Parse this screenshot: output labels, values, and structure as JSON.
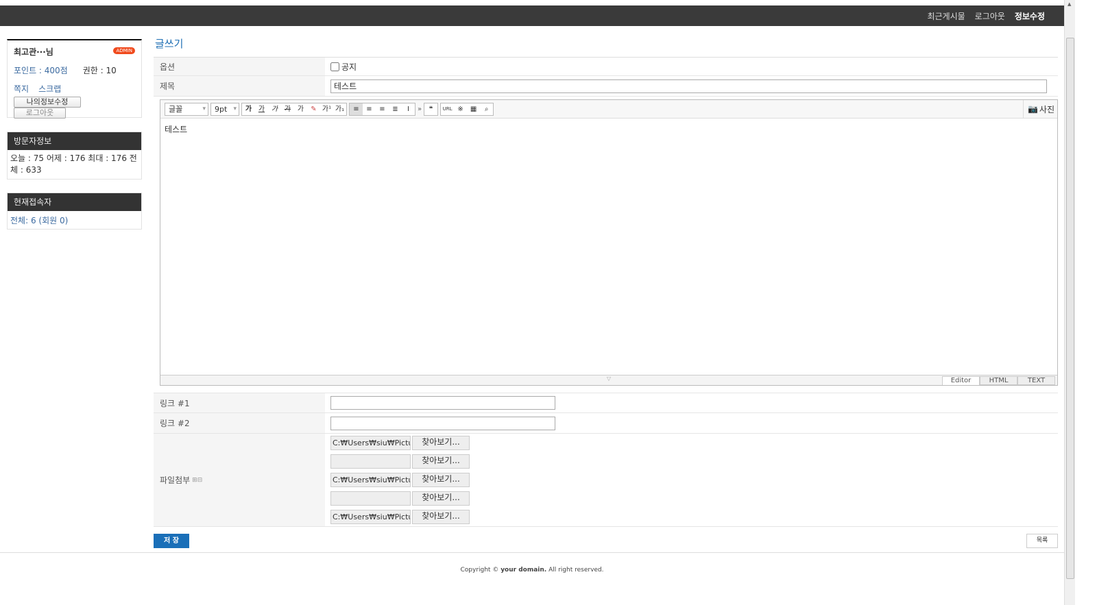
{
  "topnav": [
    "최근게시물",
    "로그아웃",
    "정보수정"
  ],
  "login": {
    "name": "최고관···님",
    "badge": "ADMIN",
    "points": "포인트 : 400점",
    "level": "권한 : 10",
    "memo": "쪽지",
    "scrap": "스크랩",
    "edit_btn": "나의정보수정",
    "logout_btn": "로그아웃"
  },
  "visitor": {
    "title": "방문자정보",
    "text": "오늘 : 75 어제 : 176 최대 : 176 전체 : 633"
  },
  "connect": {
    "title": "현재접속자",
    "text": "전체: 6 (회원 0)"
  },
  "page_title": "글쓰기",
  "form": {
    "option_label": "옵션",
    "notice_label": "공지",
    "subject_label": "제목",
    "subject_value": "테스트",
    "font_select": "글꼴",
    "size_select": "9pt",
    "photo_btn": "사진",
    "content": "테스트",
    "toolbar_icons": [
      "bold",
      "underline",
      "italic",
      "strike",
      "font-color",
      "bg-color",
      "superscript",
      "subscript",
      "align-left",
      "align-center",
      "align-right",
      "justify",
      "line-height",
      "more",
      "quote",
      "url",
      "special-char",
      "table",
      "search"
    ],
    "editor_tabs": [
      "Editor",
      "HTML",
      "TEXT"
    ],
    "link1_label": "링크 #1",
    "link2_label": "링크 #2",
    "file_label": "파일첨부",
    "files": [
      "C:₩Users₩siu₩Pictures",
      "",
      "C:₩Users₩siu₩Pictures",
      "",
      "C:₩Users₩siu₩Pictures"
    ],
    "browse_label": "찾아보기..."
  },
  "save_btn": "저 장",
  "list_btn": "목록",
  "footer": {
    "pre": "Copyright © ",
    "domain": "your domain.",
    "post": " All right reserved."
  }
}
